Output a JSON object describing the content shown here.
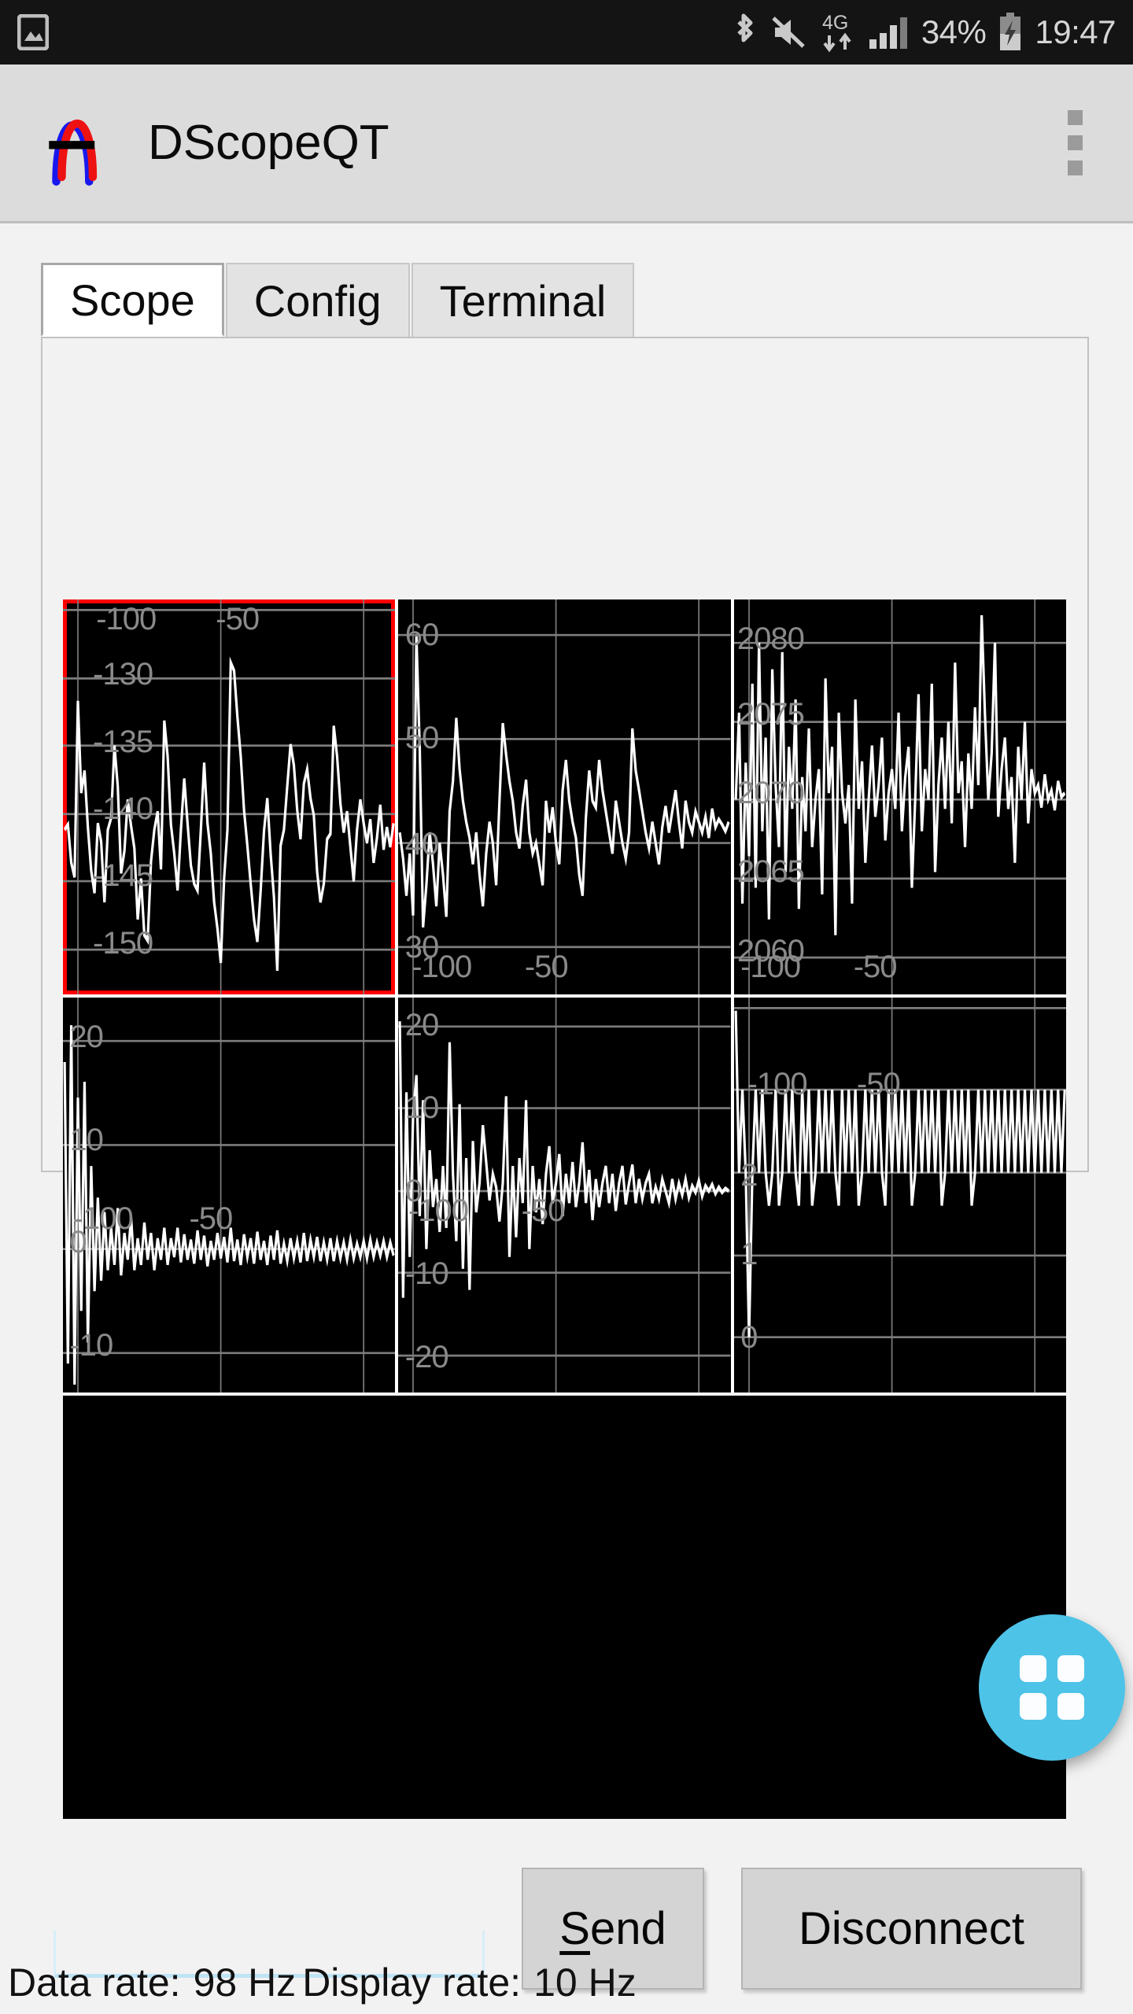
{
  "status_bar": {
    "icons": [
      "screenshot-icon",
      "bluetooth-icon",
      "mute-icon",
      "4g-icon",
      "signal-icon",
      "battery-charging-icon"
    ],
    "network_label": "4G",
    "battery_percent": "34%",
    "time": "19:47"
  },
  "app_bar": {
    "title": "DScopeQT",
    "logo": "sine-wave-logo-icon",
    "overflow": "overflow-menu-icon",
    "background": "#dcdcdc"
  },
  "tabs": [
    {
      "label": "Scope",
      "active": true
    },
    {
      "label": "Config",
      "active": false
    },
    {
      "label": "Terminal",
      "active": false
    }
  ],
  "scope": {
    "selected_plot_index": 0,
    "selection_color": "#ff0000",
    "trace_color": "#ffffff",
    "grid_color": "#8a8a8a",
    "background": "#000000",
    "plots": [
      {
        "name": "plot-1",
        "selected": true,
        "y_labels": [
          "-130",
          "-135",
          "-140",
          "-145",
          "-150"
        ],
        "x_labels": [
          "-100",
          "-50"
        ]
      },
      {
        "name": "plot-2",
        "selected": false,
        "y_labels": [
          "60",
          "50",
          "40",
          "30"
        ],
        "x_labels": [
          "-100",
          "-50"
        ]
      },
      {
        "name": "plot-3",
        "selected": false,
        "y_labels": [
          "2080",
          "2075",
          "2070",
          "2065",
          "2060"
        ],
        "x_labels": [
          "-100",
          "-50"
        ]
      },
      {
        "name": "plot-4",
        "selected": false,
        "y_labels": [
          "20",
          "10",
          "0",
          "-10"
        ],
        "x_labels": [
          "-100",
          "-50"
        ]
      },
      {
        "name": "plot-5",
        "selected": false,
        "y_labels": [
          "20",
          "10",
          "0",
          "-10",
          "-20"
        ],
        "x_labels": [
          "-100",
          "-50"
        ]
      },
      {
        "name": "plot-6",
        "selected": false,
        "y_labels": [
          "2",
          "1",
          "0"
        ],
        "x_labels": [
          "-100",
          "-50"
        ]
      }
    ]
  },
  "chart_data": {
    "type": "line",
    "title": "",
    "xlabel": "",
    "ylabel": "",
    "grid": true,
    "legend": "none",
    "panels": [
      {
        "name": "plot-1",
        "selected": true,
        "ylim": [
          -152,
          -126
        ],
        "xlim": [
          -128,
          -36
        ],
        "yticks": [
          -130,
          -135,
          -140,
          -145,
          -150
        ],
        "xticks": [
          -100,
          -50
        ],
        "values": [
          -141.2,
          -140.8,
          -143.5,
          -144.6,
          -131.2,
          -138.0,
          -136.4,
          -140.6,
          -143.8,
          -145.4,
          -140.2,
          -141.6,
          -146.0,
          -141.0,
          -140.1,
          -134.6,
          -137.6,
          -144.0,
          -142.4,
          -138.8,
          -140.4,
          -142.0,
          -147.2,
          -144.2,
          -148.4,
          -148.8,
          -142.8,
          -141.0,
          -139.6,
          -143.6,
          -133.6,
          -136.0,
          -140.8,
          -143.0,
          -145.8,
          -141.2,
          -137.4,
          -140.2,
          -143.2,
          -144.6,
          -145.1,
          -141.2,
          -136.2,
          -140.6,
          -143.0,
          -146.0,
          -148.0,
          -150.6,
          -144.0,
          -141.0,
          -129.4,
          -130.0,
          -133.4,
          -136.2,
          -140.0,
          -142.6,
          -145.4,
          -148.0,
          -149.6,
          -146.0,
          -141.4,
          -139.0,
          -143.0,
          -146.2,
          -150.8,
          -142.6,
          -141.0,
          -138.0,
          -135.0,
          -136.6,
          -140.0,
          -142.0,
          -138.2,
          -137.2,
          -139.4,
          -140.6,
          -144.6,
          -146.8,
          -145.4,
          -142.0,
          -141.8,
          -133.8,
          -136.0,
          -139.4,
          -141.4,
          -140.0,
          -142.4,
          -144.8,
          -141.2,
          -139.0,
          -140.6,
          -142.0
        ]
      },
      {
        "name": "plot-2",
        "selected": false,
        "ylim": [
          26,
          64
        ],
        "xlim": [
          -128,
          -36
        ],
        "yticks": [
          60,
          50,
          40,
          30
        ],
        "xticks": [
          -100,
          -50
        ],
        "values": [
          41.0,
          38.5,
          35.0,
          39.0,
          33.0,
          60.5,
          49.0,
          31.5,
          36.0,
          41.0,
          38.0,
          34.0,
          39.5,
          36.5,
          32.5,
          43.0,
          46.0,
          52.0,
          47.0,
          44.0,
          42.0,
          40.5,
          38.0,
          41.0,
          37.0,
          34.0,
          39.0,
          42.0,
          40.0,
          36.0,
          44.0,
          50.5,
          47.5,
          45.0,
          43.0,
          40.0,
          38.5,
          42.0,
          44.5,
          41.0,
          39.0,
          40.0,
          38.0,
          36.0,
          44.0,
          41.0,
          43.5,
          40.0,
          38.0,
          45.0,
          48.0,
          44.0,
          42.0,
          40.5,
          37.0,
          35.0,
          42.5,
          46.0,
          44.0,
          43.5,
          48.0,
          45.0,
          43.0,
          41.0,
          39.0,
          44.0,
          42.0,
          40.0,
          38.5,
          41.0,
          50.0,
          47.0,
          45.0,
          43.0,
          41.0,
          39.5,
          42.0,
          40.0,
          38.0,
          41.5,
          43.0,
          40.0,
          42.0,
          44.0,
          41.0,
          39.0,
          43.0,
          41.0,
          40.0,
          42.0,
          41.0,
          40.0
        ]
      },
      {
        "name": "plot-3",
        "selected": false,
        "ylim": [
          2057,
          2083
        ],
        "xlim": [
          -128,
          -36
        ],
        "yticks": [
          2080,
          2075,
          2070,
          2065,
          2060
        ],
        "xticks": [
          -100,
          -50
        ],
        "values": [
          2070.0,
          2075.5,
          2063.0,
          2072.0,
          2066.0,
          2077.0,
          2064.0,
          2080.5,
          2068.0,
          2074.0,
          2062.5,
          2078.0,
          2071.0,
          2067.0,
          2080.0,
          2065.0,
          2073.0,
          2069.0,
          2076.0,
          2063.5,
          2071.5,
          2068.0,
          2074.5,
          2066.5,
          2070.0,
          2072.0,
          2064.5,
          2077.5,
          2069.5,
          2073.0,
          2061.5,
          2075.0,
          2070.5,
          2067.5,
          2071.0,
          2063.0,
          2076.0,
          2069.0,
          2072.5,
          2065.5,
          2070.0,
          2073.5,
          2068.5,
          2071.0,
          2074.0,
          2066.0,
          2070.5,
          2072.0,
          2069.0,
          2075.0,
          2067.0,
          2071.5,
          2073.0,
          2064.0,
          2070.0,
          2076.5,
          2068.0,
          2072.0,
          2070.0,
          2077.0,
          2065.0,
          2071.0,
          2073.5,
          2069.5,
          2074.5,
          2067.5,
          2078.5,
          2070.5,
          2072.5,
          2066.0,
          2073.0,
          2069.0,
          2075.5,
          2071.0,
          2082.0,
          2076.0,
          2070.0,
          2073.0,
          2080.5,
          2068.5,
          2072.0,
          2074.0,
          2069.0,
          2071.5,
          2066.5,
          2073.5,
          2070.0,
          2075.0,
          2068.0,
          2072.0,
          2070.5,
          2071.0
        ]
      },
      {
        "name": "plot-4",
        "selected": false,
        "ylim": [
          -14,
          24
        ],
        "xlim": [
          -128,
          -36
        ],
        "yticks": [
          20,
          10,
          0,
          -10
        ],
        "xticks": [
          -100,
          -50
        ],
        "values": [
          18.0,
          -11.0,
          21.5,
          -13.0,
          14.5,
          -6.0,
          16.0,
          -9.0,
          8.0,
          -4.0,
          5.0,
          -3.0,
          3.5,
          -2.0,
          2.0,
          -1.5,
          4.0,
          -2.5,
          1.5,
          -1.0,
          3.0,
          -2.0,
          1.0,
          -1.5,
          2.5,
          -1.0,
          1.5,
          -2.0,
          1.0,
          -1.0,
          2.0,
          -1.5,
          1.0,
          -0.8,
          2.0,
          -1.2,
          1.4,
          -1.0,
          0.9,
          -1.4,
          1.8,
          -1.0,
          1.2,
          -1.6,
          0.8,
          -1.0,
          1.5,
          -0.9,
          1.1,
          -1.3,
          2.0,
          -1.1,
          0.9,
          -1.5,
          1.3,
          -0.8,
          1.0,
          -1.2,
          1.6,
          -1.0,
          0.8,
          -1.4,
          1.2,
          -0.9,
          1.5,
          -1.1,
          0.7,
          -1.3,
          1.0,
          -0.8,
          1.4,
          -1.0,
          0.9,
          -1.2,
          1.1,
          -0.7,
          1.3,
          -1.0,
          0.8,
          -1.1,
          1.0,
          -0.9,
          1.2,
          -0.8,
          0.9,
          -1.0,
          1.1,
          -0.9,
          0.8,
          -1.0,
          0.9,
          -0.8
        ]
      },
      {
        "name": "plot-5",
        "selected": false,
        "ylim": [
          -24,
          24
        ],
        "xlim": [
          -128,
          -36
        ],
        "yticks": [
          20,
          10,
          0,
          -10,
          -20
        ],
        "xticks": [
          -100,
          -50
        ],
        "values": [
          20.5,
          -13.0,
          12.0,
          -8.0,
          9.0,
          14.0,
          -3.0,
          11.0,
          -7.0,
          5.0,
          -2.0,
          1.5,
          -5.0,
          3.0,
          -4.5,
          18.0,
          2.0,
          -6.0,
          10.5,
          -9.5,
          4.0,
          -12.0,
          6.0,
          -2.5,
          1.0,
          8.0,
          3.5,
          -1.0,
          2.0,
          0.5,
          -3.5,
          1.0,
          11.5,
          -8.0,
          2.5,
          -5.5,
          4.0,
          -1.5,
          11.0,
          -7.0,
          3.0,
          -2.0,
          1.5,
          -4.0,
          2.0,
          5.5,
          -1.0,
          1.0,
          4.5,
          -3.0,
          2.0,
          -1.5,
          3.0,
          -2.0,
          1.0,
          6.0,
          -1.0,
          2.5,
          -3.5,
          1.5,
          -2.0,
          1.0,
          3.0,
          -1.5,
          2.0,
          -2.5,
          1.0,
          2.0,
          -1.0,
          1.5,
          -2.0,
          1.0,
          2.5,
          -1.5,
          1.0,
          -1.0,
          2.0,
          -1.5,
          1.0,
          1.5,
          -1.0,
          2.0,
          -1.5,
          1.0,
          -0.5,
          1.5,
          -1.0,
          0.8,
          1.2,
          -1.0,
          0.6,
          0.4
        ]
      },
      {
        "name": "plot-6",
        "selected": false,
        "ylim": [
          -1.4,
          3.4
        ],
        "xlim": [
          -128,
          -36
        ],
        "yticks": [
          2,
          1,
          0
        ],
        "xticks": [
          -100,
          -50
        ],
        "values": [
          3.0,
          1.0,
          2.0,
          1.0,
          -1.0,
          1.0,
          2.0,
          1.0,
          2.0,
          1.0,
          0.6,
          1.0,
          2.0,
          0.6,
          1.0,
          2.0,
          1.0,
          2.0,
          1.0,
          0.6,
          2.0,
          1.0,
          2.0,
          0.6,
          1.0,
          2.0,
          1.0,
          2.0,
          1.0,
          2.0,
          1.0,
          0.6,
          2.0,
          1.0,
          2.0,
          1.0,
          2.0,
          0.6,
          1.0,
          2.0,
          1.0,
          2.0,
          1.0,
          2.0,
          1.0,
          0.6,
          2.0,
          1.0,
          2.0,
          1.0,
          2.0,
          1.0,
          2.0,
          0.6,
          1.0,
          2.0,
          1.0,
          2.0,
          1.0,
          2.0,
          1.0,
          2.0,
          0.6,
          1.0,
          2.0,
          1.0,
          2.0,
          1.0,
          2.0,
          1.0,
          2.0,
          0.6,
          1.0,
          2.0,
          1.0,
          2.0,
          1.0,
          2.0,
          1.0,
          2.0,
          1.0,
          2.0,
          1.0,
          2.0,
          1.0,
          2.0,
          1.0,
          2.0,
          1.0,
          2.0,
          1.0,
          2.0
        ]
      }
    ]
  },
  "terminal_pane": {
    "name": "terminal-output",
    "background": "#000000",
    "text": ""
  },
  "fab": {
    "name": "grid-layout-fab",
    "icon": "grid-2x2-icon",
    "color": "#4ec3e8"
  },
  "bottom": {
    "input_value": "",
    "input_placeholder": "",
    "send_label_accel": "S",
    "send_label_rest": "end",
    "disconnect_label": "Disconnect"
  },
  "footer": {
    "data_rate_label": "Data rate:",
    "data_rate_value": "98 Hz",
    "display_rate_label": "Display rate:",
    "display_rate_value": "10 Hz"
  }
}
